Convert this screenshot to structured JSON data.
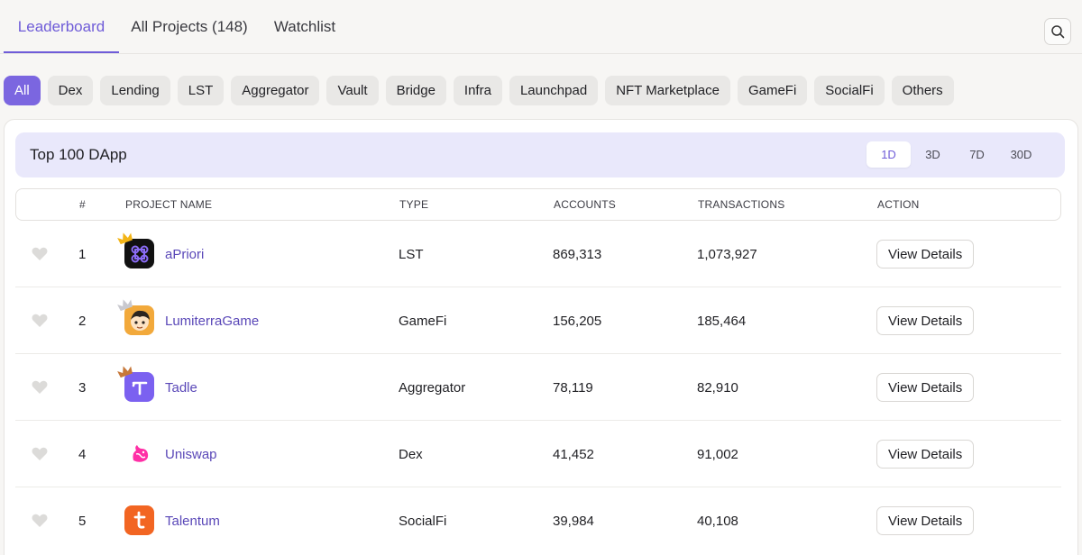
{
  "tabs": [
    {
      "label": "Leaderboard",
      "active": true
    },
    {
      "label": "All Projects (148)",
      "active": false
    },
    {
      "label": "Watchlist",
      "active": false
    }
  ],
  "search": {
    "icon": "search-icon"
  },
  "filters": [
    "All",
    "Dex",
    "Lending",
    "LST",
    "Aggregator",
    "Vault",
    "Bridge",
    "Infra",
    "Launchpad",
    "NFT Marketplace",
    "GameFi",
    "SocialFi",
    "Others"
  ],
  "active_filter": "All",
  "card": {
    "title": "Top 100 DApp",
    "ranges": [
      "1D",
      "3D",
      "7D",
      "30D"
    ],
    "active_range": "1D"
  },
  "table": {
    "headers": {
      "rank": "#",
      "name": "PROJECT NAME",
      "type": "TYPE",
      "accounts": "ACCOUNTS",
      "transactions": "TRANSACTIONS",
      "action": "ACTION"
    },
    "rows": [
      {
        "rank": "1",
        "name": "aPriori",
        "type": "LST",
        "accounts": "869,313",
        "transactions": "1,073,927",
        "action": "View Details",
        "icon": "apriori-logo-icon",
        "icon_color": "#111111",
        "medal": "gold"
      },
      {
        "rank": "2",
        "name": "LumiterraGame",
        "type": "GameFi",
        "accounts": "156,205",
        "transactions": "185,464",
        "action": "View Details",
        "icon": "lumiterra-logo-icon",
        "icon_color": "#f2a93b",
        "medal": "silver"
      },
      {
        "rank": "3",
        "name": "Tadle",
        "type": "Aggregator",
        "accounts": "78,119",
        "transactions": "82,910",
        "action": "View Details",
        "icon": "tadle-logo-icon",
        "icon_color": "#7b61f0",
        "medal": "bronze"
      },
      {
        "rank": "4",
        "name": "Uniswap",
        "type": "Dex",
        "accounts": "41,452",
        "transactions": "91,002",
        "action": "View Details",
        "icon": "uniswap-logo-icon",
        "icon_color": "#ff2fa6",
        "medal": ""
      },
      {
        "rank": "5",
        "name": "Talentum",
        "type": "SocialFi",
        "accounts": "39,984",
        "transactions": "40,108",
        "action": "View Details",
        "icon": "talentum-logo-icon",
        "icon_color": "#f26522",
        "medal": ""
      }
    ]
  },
  "colors": {
    "accent": "#7b66e0",
    "header_bg": "#e9e8fb",
    "page_bg": "#f7f6f4"
  }
}
